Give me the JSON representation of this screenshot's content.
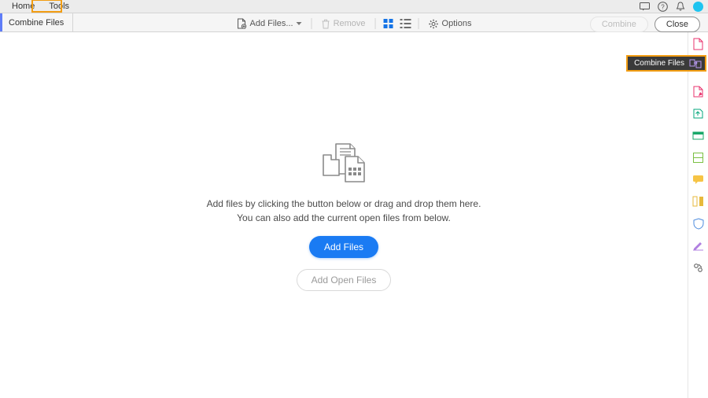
{
  "titlebar": {
    "tabs": {
      "home": "Home",
      "tools": "Tools"
    },
    "icons": {
      "chat": "chat-icon",
      "help": "help-icon",
      "bell": "bell-icon",
      "avatar": "avatar"
    }
  },
  "doc_tabs": {
    "combine": "Combine Files"
  },
  "commands": {
    "add_files": "Add Files...",
    "remove": "Remove",
    "options": "Options",
    "view_grid": "grid",
    "view_list": "list"
  },
  "actions": {
    "combine": "Combine",
    "close": "Close"
  },
  "empty_state": {
    "hint1": "Add files by clicking the button below or drag and drop them here.",
    "hint2": "You can also add the current open files from below.",
    "add_files_btn": "Add Files",
    "add_open_files_btn": "Add Open Files"
  },
  "right_rail": {
    "flyout_label": "Combine Files",
    "tools": [
      "create-pdf",
      "combine-files",
      "edit-pdf",
      "export-pdf",
      "organize",
      "scan-ocr",
      "comment",
      "compare",
      "protect",
      "fill-sign",
      "more-tools"
    ]
  },
  "colors": {
    "accent": "#1a7bf3",
    "highlight": "#f29d13"
  }
}
